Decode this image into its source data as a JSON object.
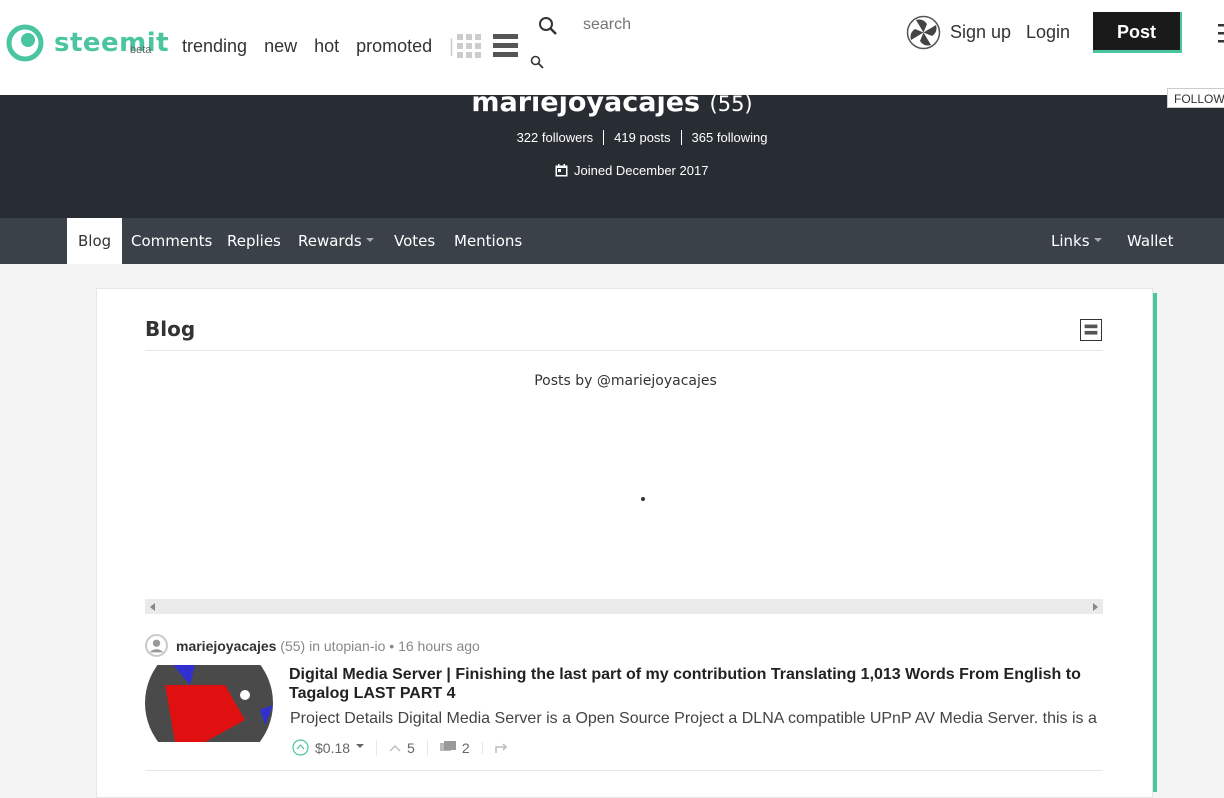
{
  "header": {
    "logo_text": "steemit",
    "logo_beta": "beta",
    "nav": [
      "trending",
      "new",
      "hot",
      "promoted"
    ],
    "nav_separator": "|",
    "search_placeholder": "search",
    "signup_label": "Sign up",
    "login_label": "Login",
    "post_label": "Post"
  },
  "profile": {
    "username": "mariejoyacajes",
    "reputation": "(55)",
    "followers": "322 followers",
    "posts": "419 posts",
    "following": "365 following",
    "joined": "Joined December 2017",
    "follow_label": "FOLLOW"
  },
  "tabs": {
    "blog": "Blog",
    "comments": "Comments",
    "replies": "Replies",
    "rewards": "Rewards",
    "votes": "Votes",
    "mentions": "Mentions",
    "links": "Links",
    "wallet": "Wallet"
  },
  "blog": {
    "title": "Blog",
    "posts_by": "Posts by @mariejoyacajes"
  },
  "post": {
    "author": "mariejoyacajes",
    "author_rep": "(55)",
    "in_label": "in",
    "category": "utopian-io",
    "bullet": "•",
    "time": "16 hours ago",
    "title": "Digital Media Server | Finishing the last part of my contribution Translating 1,013 Words From English to Tagalog LAST PART 4",
    "excerpt": "Project Details Digital Media Server is a Open Source Project a DLNA compatible UPnP AV Media Server. this is a",
    "payout": "$0.18",
    "votes": "5",
    "comments": "2"
  },
  "colors": {
    "brand": "#4bc4a0",
    "hero_bg": "#282d33",
    "tabs_bg": "#3b4149"
  }
}
